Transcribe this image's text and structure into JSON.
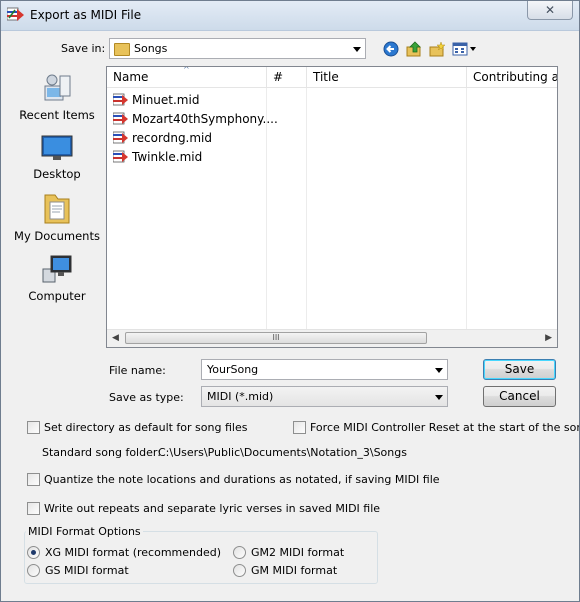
{
  "window": {
    "title": "Export as MIDI File",
    "close_glyph": "✕"
  },
  "save_in": {
    "label": "Save in:",
    "value": "Songs"
  },
  "toolbar": {
    "back_icon": "back-arrow-icon",
    "up_icon": "up-folder-icon",
    "new_folder_icon": "new-folder-icon",
    "views_icon": "views-menu-icon"
  },
  "places": [
    {
      "label": "Recent Items",
      "icon": "recent-items-icon"
    },
    {
      "label": "Desktop",
      "icon": "desktop-icon"
    },
    {
      "label": "My Documents",
      "icon": "documents-icon"
    },
    {
      "label": "Computer",
      "icon": "computer-icon"
    }
  ],
  "file_list": {
    "columns": [
      "Name",
      "#",
      "Title",
      "Contributing art"
    ],
    "files": [
      "Minuet.mid",
      "Mozart40thSymphony....",
      "recordng.mid",
      "Twinkle.mid"
    ],
    "scroll_grip": "III"
  },
  "file_name": {
    "label": "File name:",
    "value": "YourSong"
  },
  "save_as_type": {
    "label": "Save as type:",
    "value": "MIDI (*.mid)"
  },
  "buttons": {
    "save": "Save",
    "cancel": "Cancel"
  },
  "options": {
    "set_default_dir": "Set directory as default for song files",
    "force_reset": "Force MIDI Controller Reset at the start of the song",
    "standard_folder_label": "Standard song folder:",
    "standard_folder_path": "C:\\Users\\Public\\Documents\\Notation_3\\Songs",
    "quantize": "Quantize the note locations and durations as notated, if saving MIDI file",
    "write_repeats": "Write out repeats and separate lyric verses in saved MIDI file"
  },
  "midi_format": {
    "title": "MIDI Format Options",
    "xg": "XG MIDI format (recommended)",
    "gs": "GS MIDI format",
    "gm2": "GM2 MIDI format",
    "gm": "GM MIDI format",
    "selected": "xg"
  }
}
